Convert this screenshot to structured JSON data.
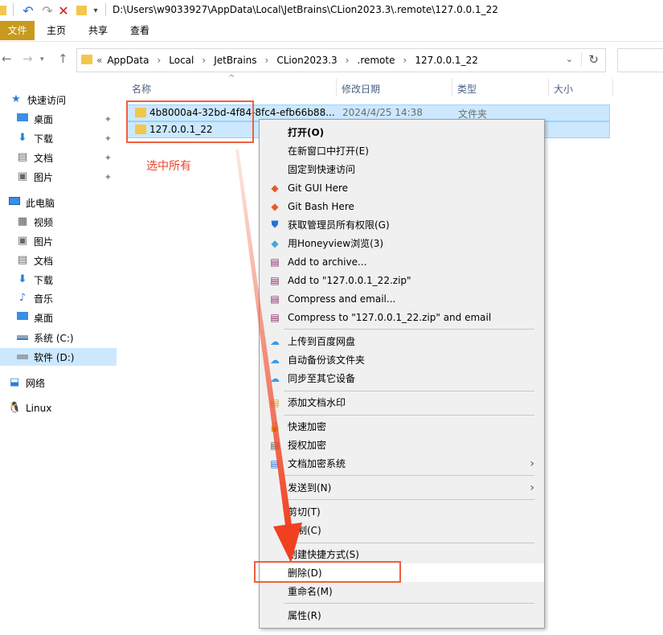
{
  "window": {
    "path": "D:\\Users\\w9033927\\AppData\\Local\\JetBrains\\CLion2023.3\\.remote\\127.0.0.1_22"
  },
  "ribbon": {
    "tabs": [
      "文件",
      "主页",
      "共享",
      "查看"
    ]
  },
  "address": {
    "prefix": "«",
    "crumbs": [
      "AppData",
      "Local",
      "JetBrains",
      "CLion2023.3",
      ".remote",
      "127.0.0.1_22"
    ],
    "separator": "›"
  },
  "sidebar": {
    "quick_access": "快速访问",
    "pinned": [
      "桌面",
      "下载",
      "文档",
      "图片"
    ],
    "this_pc": "此电脑",
    "pc_items": [
      "视频",
      "图片",
      "文档",
      "下载",
      "音乐",
      "桌面",
      "系统 (C:)",
      "软件 (D:)"
    ],
    "network": "网络",
    "linux": "Linux"
  },
  "columns": {
    "name": "名称",
    "date": "修改日期",
    "type": "类型",
    "size": "大小"
  },
  "files": [
    {
      "name": "4b8000a4-32bd-4f84-8fc4-efb66b88...",
      "date": "2024/4/25 14:38",
      "type": "文件夹"
    },
    {
      "name": "127.0.0.1_22",
      "date": "",
      "type": ""
    }
  ],
  "annotation": {
    "text": "选中所有",
    "color": "#e8452c"
  },
  "context_menu": {
    "items": [
      {
        "label": "打开(O)",
        "bold": true
      },
      {
        "label": "在新窗口中打开(E)"
      },
      {
        "label": "固定到快速访问"
      },
      {
        "label": "Git GUI Here",
        "icon": "git-gui-icon"
      },
      {
        "label": "Git Bash Here",
        "icon": "git-bash-icon"
      },
      {
        "label": "获取管理员所有权限(G)",
        "icon": "shield-icon"
      },
      {
        "label": "用Honeyview浏览(3)",
        "icon": "honeyview-icon"
      },
      {
        "label": "Add to archive...",
        "icon": "winrar-icon"
      },
      {
        "label": "Add to \"127.0.0.1_22.zip\"",
        "icon": "winrar-icon"
      },
      {
        "label": "Compress and email...",
        "icon": "winrar-icon"
      },
      {
        "label": "Compress to \"127.0.0.1_22.zip\" and email",
        "icon": "winrar-icon"
      },
      {
        "label": "上传到百度网盘",
        "icon": "baidu-cloud-icon"
      },
      {
        "label": "自动备份该文件夹",
        "icon": "baidu-cloud-icon"
      },
      {
        "label": "同步至其它设备",
        "icon": "baidu-cloud-icon"
      },
      {
        "label": "添加文档水印",
        "icon": "watermark-icon"
      },
      {
        "label": "快速加密",
        "icon": "lock-icon"
      },
      {
        "label": "授权加密",
        "icon": "lock-icon"
      },
      {
        "label": "文档加密系统",
        "icon": "lock-icon",
        "submenu": true
      },
      {
        "label": "发送到(N)",
        "submenu": true
      },
      {
        "label": "剪切(T)"
      },
      {
        "label": "复制(C)"
      },
      {
        "label": "创建快捷方式(S)"
      },
      {
        "label": "删除(D)"
      },
      {
        "label": "重命名(M)"
      },
      {
        "label": "属性(R)"
      }
    ]
  },
  "colors": {
    "selection": "#cce8ff",
    "selection_border": "#99d1ff",
    "annotation": "#f06040",
    "folder": "#f3c64c",
    "file_tab": "#c89a1e"
  }
}
